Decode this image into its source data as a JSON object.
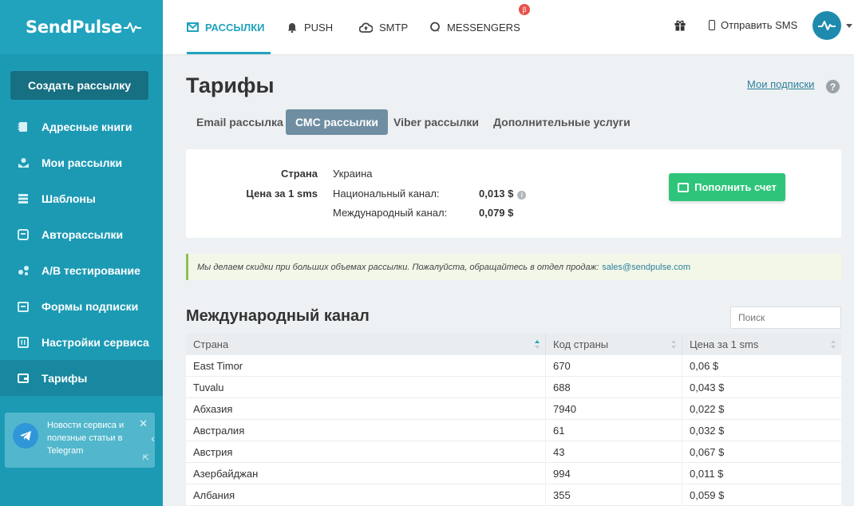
{
  "brand": {
    "name": "SendPulse"
  },
  "sidebar": {
    "create_button": "Создать рассылку",
    "items": [
      {
        "label": "Адресные книги",
        "icon": "address-book-icon",
        "active": false
      },
      {
        "label": "Мои рассылки",
        "icon": "campaigns-icon",
        "active": false
      },
      {
        "label": "Шаблоны",
        "icon": "templates-icon",
        "active": false
      },
      {
        "label": "Авторассылки",
        "icon": "automation-icon",
        "active": false
      },
      {
        "label": "A/B тестирование",
        "icon": "ab-test-icon",
        "active": false
      },
      {
        "label": "Формы подписки",
        "icon": "forms-icon",
        "active": false
      },
      {
        "label": "Настройки сервиса",
        "icon": "settings-icon",
        "active": false
      },
      {
        "label": "Тарифы",
        "icon": "wallet-icon",
        "active": true
      }
    ],
    "telegram_card": {
      "text": "Новости сервиса и полезные статьи в Telegram"
    }
  },
  "topbar": {
    "tabs": [
      {
        "label": "РАССЫЛКИ",
        "icon": "mail-icon",
        "active": true
      },
      {
        "label": "PUSH",
        "icon": "bell-icon",
        "active": false
      },
      {
        "label": "SMTP",
        "icon": "cloud-icon",
        "active": false
      },
      {
        "label": "MESSENGERS",
        "icon": "chat-icon",
        "active": false,
        "badge": "β"
      }
    ],
    "gift_icon": "gift-icon",
    "sms_link": "Отправить SMS"
  },
  "page": {
    "title": "Тарифы",
    "my_subscriptions": "Мои подписки",
    "subtabs": [
      {
        "label": "Email рассылка",
        "active": false
      },
      {
        "label": "СМС рассылки",
        "active": true
      },
      {
        "label": "Viber рассылки",
        "active": false
      },
      {
        "label": "Дополнительные услуги",
        "active": false
      }
    ]
  },
  "pricing": {
    "country_label": "Страна",
    "country_value": "Украина",
    "price_label": "Цена за 1 sms",
    "national_label": "Национальный канал:",
    "national_price": "0,013 $",
    "international_label": "Международный канал:",
    "international_price": "0,079 $",
    "topup_button": "Пополнить счет"
  },
  "notice": {
    "text": "Мы делаем скидки при больших объемах рассылки. Пожалуйста, обращайтесь в отдел продаж:",
    "email": "sales@sendpulse.com"
  },
  "international": {
    "title": "Международный канал",
    "search_placeholder": "Поиск",
    "columns": [
      "Страна",
      "Код страны",
      "Цена за 1 sms"
    ],
    "rows": [
      [
        "East Timor",
        "670",
        "0,06 $"
      ],
      [
        "Tuvalu",
        "688",
        "0,043 $"
      ],
      [
        "Абхазия",
        "7940",
        "0,022 $"
      ],
      [
        "Австралия",
        "61",
        "0,032 $"
      ],
      [
        "Австрия",
        "43",
        "0,067 $"
      ],
      [
        "Азербайджан",
        "994",
        "0,011 $"
      ],
      [
        "Албания",
        "355",
        "0,059 $"
      ]
    ]
  },
  "colors": {
    "accent": "#21a3be",
    "success": "#2ec57b",
    "sidebar": "#1c9ab4"
  }
}
